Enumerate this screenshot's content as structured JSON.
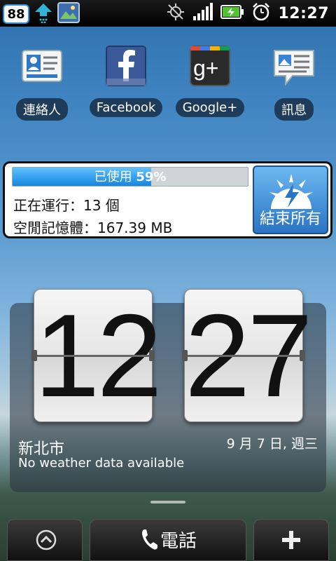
{
  "statusbar": {
    "notification_count": "88",
    "time": "12:27"
  },
  "apps": [
    {
      "label": "連絡人",
      "icon": "contacts-icon"
    },
    {
      "label": "Facebook",
      "icon": "facebook-icon"
    },
    {
      "label": "Google+",
      "icon": "google-plus-icon"
    },
    {
      "label": "訊息",
      "icon": "messages-icon"
    }
  ],
  "task_manager": {
    "usage_prefix": "已使用",
    "usage_percent": "59%",
    "usage_fraction": 0.59,
    "running_label": "正在運行：13 個",
    "free_memory_label": "空閒記憶體：167.39 MB",
    "end_all_label": "結束所有"
  },
  "clock": {
    "hour": "12",
    "minute": "27",
    "city": "新北市",
    "weather": "No weather data available",
    "date": "9 月 7 日, 週三"
  },
  "dock": {
    "phone_label": "電話"
  },
  "colors": {
    "accent": "#1585e0",
    "statusbar": "#000000"
  }
}
